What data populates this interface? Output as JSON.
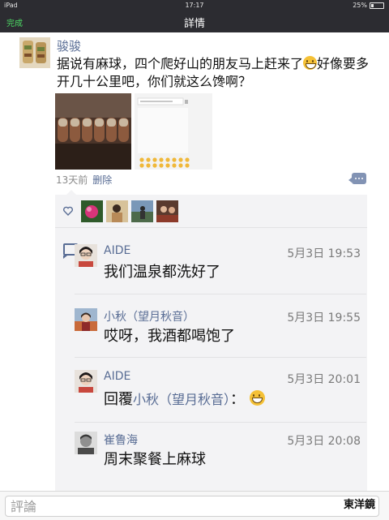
{
  "status": {
    "device": "iPad",
    "time": "17:17",
    "battery": "25%"
  },
  "nav": {
    "done_label": "完成",
    "title": "詳情"
  },
  "post": {
    "author": "骏骏",
    "text_part1": "据说有麻球，四个爬好山的朋友马上赶来了",
    "text_part2": "好像要多开几十公里吧，你们就这么馋啊？",
    "time_ago": "13天前",
    "delete_label": "删除"
  },
  "likes": {
    "count_avatars": 4
  },
  "comments": [
    {
      "name": "AIDE",
      "time": "5月3日 19:53",
      "text": "我们温泉都洗好了"
    },
    {
      "name": "小秋（望月秋音）",
      "time": "5月3日 19:55",
      "text": "哎呀，我酒都喝饱了"
    },
    {
      "name": "AIDE",
      "time": "5月3日 20:01",
      "reply_prefix": "回覆",
      "reply_target": "小秋（望月秋音）",
      "text_suffix": "："
    },
    {
      "name": "崔鲁海",
      "time": "5月3日 20:08",
      "text": "周末聚餐上麻球"
    }
  ],
  "input": {
    "placeholder": "評論"
  },
  "watermark": "東洋鏡",
  "colors": {
    "nav_bg": "#2c2c31",
    "link": "#586c94",
    "done": "#4cd964",
    "panel": "#f3f3f5"
  }
}
